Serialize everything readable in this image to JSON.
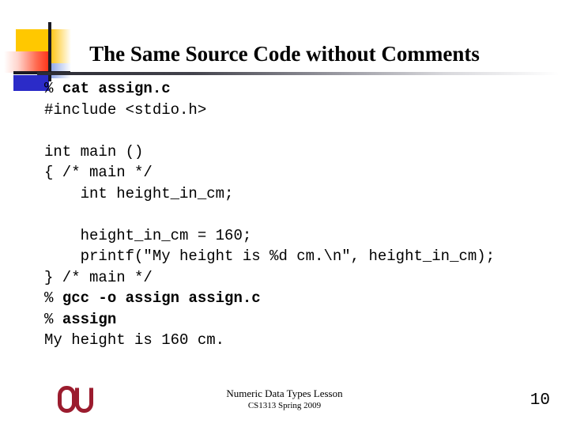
{
  "slide": {
    "title": "The Same Source Code without Comments",
    "page_number": "10",
    "accent_colors": {
      "logo_yellow": "#ffc800",
      "logo_red": "#ff2b10",
      "logo_blue": "#2b2bc8",
      "logo_line": "#1a1a24",
      "ou_crimson": "#9b1c2e",
      "text": "#000000",
      "background": "#ffffff"
    }
  },
  "code": {
    "lines": [
      {
        "prompt": "% ",
        "command": "cat assign.c",
        "bold_command": true
      },
      {
        "text": "#include <stdio.h>"
      },
      {
        "text": ""
      },
      {
        "text": "int main ()"
      },
      {
        "text": "{ /* main */"
      },
      {
        "text": "    int height_in_cm;"
      },
      {
        "text": ""
      },
      {
        "text": "    height_in_cm = 160;"
      },
      {
        "text": "    printf(\"My height is %d cm.\\n\", height_in_cm);"
      },
      {
        "text": "} /* main */"
      },
      {
        "prompt": "% ",
        "command": "gcc -o assign assign.c",
        "bold_command": true
      },
      {
        "prompt": "% ",
        "command": "assign",
        "bold_command": true
      },
      {
        "text": "My height is 160 cm."
      }
    ]
  },
  "footer": {
    "lesson": "Numeric Data Types Lesson",
    "course": "CS1313 Spring 2009",
    "logo_alt": "OU"
  }
}
